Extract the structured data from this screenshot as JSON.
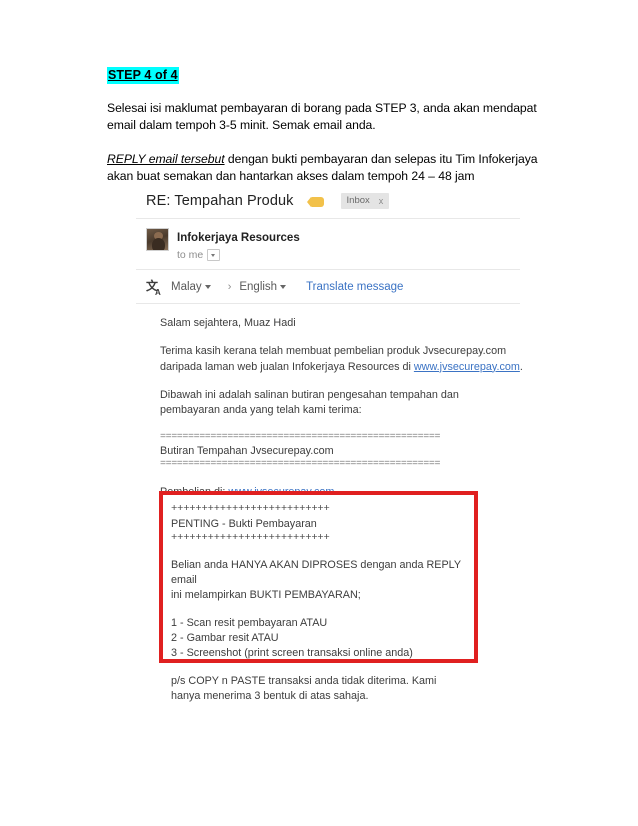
{
  "document": {
    "heading": "STEP 4 of 4",
    "paragraph1": "Selesai isi maklumat pembayaran di borang pada STEP 3, anda akan mendapat email dalam tempoh 3-5 minit. Semak email anda.",
    "paragraph2_emphasis": "REPLY email tersebut",
    "paragraph2_rest": " dengan bukti pembayaran dan selepas itu Tim Infokerjaya akan buat semakan dan hantarkan akses dalam tempoh 24 – 48 jam",
    "highlight_color": "#00ffff"
  },
  "email": {
    "subject": "RE: Tempahan Produk",
    "label_icon": "label-flag-icon",
    "inbox_chip": {
      "label": "Inbox",
      "close": "x"
    },
    "sender": {
      "name": "Infokerjaya Resources",
      "to_line": "to me",
      "avatar": "sender-avatar"
    },
    "translate_bar": {
      "icon": "translate-icon",
      "icon_main": "文",
      "icon_sub": "A",
      "source_language": "Malay",
      "arrow": "›",
      "target_language": "English",
      "action": "Translate message",
      "link_color": "#3b73c4"
    },
    "body": {
      "greeting": "Salam sejahtera, Muaz Hadi",
      "thanks_line1": "Terima kasih kerana telah membuat pembelian produk Jvsecurepay.com",
      "thanks_line2_prefix": "daripada laman web jualan Infokerjaya Resources di ",
      "thanks_line2_link": "www.jvsecurepay.com",
      "thanks_line2_suffix": ".",
      "intro_line1": "Dibawah ini adalah salinan butiran pengesahan tempahan dan",
      "intro_line2": "pembayaran anda yang telah kami terima:",
      "separator_top": "==================================================",
      "order_title": "Butiran Tempahan Jvsecurepay.com",
      "separator_mid": "==================================================",
      "purchase_prefix": "Pembelian di: ",
      "purchase_link": "www.jvsecurepay.com",
      "separator_bottom": "=================================================="
    },
    "important_box": {
      "border_color": "#e02020",
      "plus_top": "++++++++++++++++++++++++++",
      "title": "PENTING - Bukti Pembayaran",
      "plus_bottom": "++++++++++++++++++++++++++",
      "notice_line1": "Belian anda HANYA AKAN DIPROSES dengan anda REPLY email",
      "notice_line2": "ini melampirkan BUKTI PEMBAYARAN;",
      "options": [
        "1 - Scan resit pembayaran ATAU",
        "2 - Gambar resit ATAU",
        "3 - Screenshot (print screen transaksi online anda)"
      ],
      "ps_line1": "p/s COPY n PASTE transaksi anda tidak diterima. Kami",
      "ps_line2": "hanya menerima 3 bentuk di atas sahaja."
    }
  }
}
